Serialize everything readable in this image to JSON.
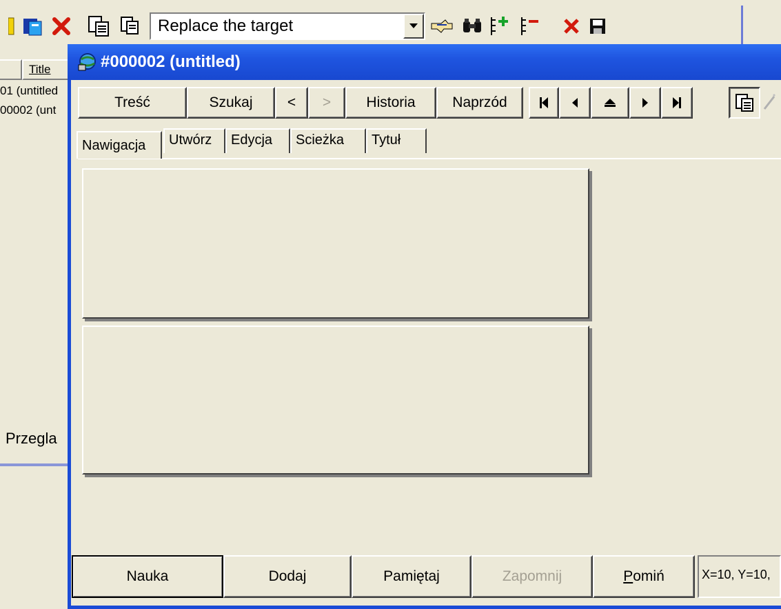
{
  "toolbar": {
    "combo_value": "Replace the target",
    "icons": [
      "yellow-bar-icon",
      "book-icon",
      "delete-x-icon",
      "copy-doc-icon",
      "paste-doc-icon",
      "combo-dropdown-icon",
      "link-hand-icon",
      "binoculars-icon",
      "add-item-icon",
      "remove-item-icon",
      "red-x-icon",
      "save-floppy-icon"
    ]
  },
  "left_pane": {
    "header_title": "Title",
    "rows": [
      "01 (untitled",
      "00002 (unt"
    ],
    "bottom_label": "Przegla"
  },
  "dialog": {
    "title": "#000002 (untitled)",
    "nav_buttons": {
      "tresc": "Treść",
      "szukaj": "Szukaj",
      "back": "<",
      "forward": ">",
      "historia": "Historia",
      "naprzod": "Naprzód"
    },
    "tabs": [
      "Nawigacja",
      "Utwórz",
      "Edycja",
      "Scieżka",
      "Tytuł"
    ],
    "bottom_buttons": {
      "nauka": "Nauka",
      "dodaj": "Dodaj",
      "pamietaj": "Pamiętaj",
      "zapomnij": "Zapomnij",
      "pomin_first": "P",
      "pomin_rest": "omiń"
    },
    "status": "X=10, Y=10,"
  }
}
